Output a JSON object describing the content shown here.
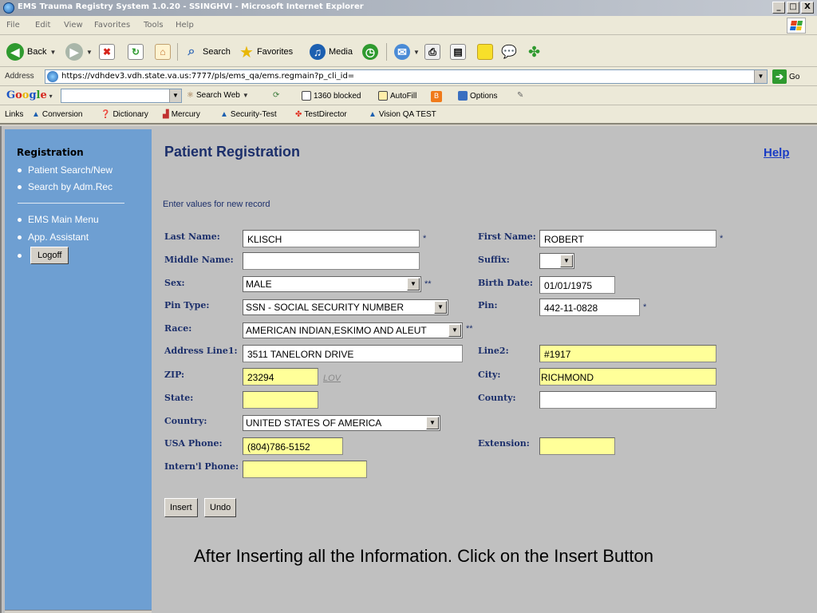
{
  "window": {
    "title": "EMS Trauma Registry System 1.0.20 - SSINGHVI - Microsoft Internet Explorer",
    "minimize": "_",
    "maximize": "□",
    "close": "X"
  },
  "menu": [
    "File",
    "Edit",
    "View",
    "Favorites",
    "Tools",
    "Help"
  ],
  "toolbar": {
    "back": "Back",
    "search": "Search",
    "favorites": "Favorites",
    "media": "Media"
  },
  "address": {
    "label": "Address",
    "url": "https://vdhdev3.vdh.state.va.us:7777/pls/ems_qa/ems.regmain?p_cli_id=",
    "go": "Go"
  },
  "google_bar": {
    "search_web": "Search Web",
    "blocked": "1360 blocked",
    "autofill": "AutoFill",
    "options": "Options"
  },
  "links": {
    "label": "Links",
    "items": [
      "Conversion",
      "Dictionary",
      "Mercury",
      "Security-Test",
      "TestDirector",
      "Vision QA TEST"
    ]
  },
  "sidebar": {
    "heading": "Registration",
    "links": [
      "Patient Search/New",
      "Search by Adm.Rec"
    ],
    "links2": [
      "EMS Main Menu",
      "App. Assistant"
    ],
    "logoff": "Logoff"
  },
  "page": {
    "title": "Patient Registration",
    "help": "Help",
    "instructions": "Enter values for new record"
  },
  "form": {
    "last_name": {
      "label": "Last Name:",
      "value": "KLISCH",
      "req": "*"
    },
    "first_name": {
      "label": "First Name:",
      "value": "ROBERT",
      "req": "*"
    },
    "middle_name": {
      "label": "Middle Name:",
      "value": ""
    },
    "suffix": {
      "label": "Suffix:",
      "value": ""
    },
    "sex": {
      "label": "Sex:",
      "value": "MALE",
      "req": "**"
    },
    "birth_date": {
      "label": "Birth Date:",
      "value": "01/01/1975"
    },
    "pin_type": {
      "label": "Pin Type:",
      "value": "SSN - SOCIAL SECURITY NUMBER"
    },
    "pin": {
      "label": "Pin:",
      "value": "442-11-0828",
      "req": "*"
    },
    "race": {
      "label": "Race:",
      "value": "AMERICAN INDIAN,ESKIMO AND ALEUT",
      "req": "**"
    },
    "address_line1": {
      "label": "Address Line1:",
      "value": "3511 TANELORN DRIVE"
    },
    "line2": {
      "label": "Line2:",
      "value": "#1917"
    },
    "zip": {
      "label": "ZIP:",
      "value": "23294",
      "lov": "LOV"
    },
    "city": {
      "label": "City:",
      "value": "RICHMOND"
    },
    "state": {
      "label": "State:",
      "value": ""
    },
    "county": {
      "label": "County:",
      "value": ""
    },
    "country": {
      "label": "Country:",
      "value": "UNITED STATES OF AMERICA"
    },
    "usa_phone": {
      "label": "USA Phone:",
      "value": "(804)786-5152"
    },
    "extension": {
      "label": "Extension:",
      "value": ""
    },
    "intl_phone": {
      "label": "Intern'l Phone:",
      "value": ""
    }
  },
  "buttons": {
    "insert": "Insert",
    "undo": "Undo"
  },
  "caption": "After Inserting all the Information. Click on the Insert Button",
  "colors": {
    "sidebar": "#6e9fd2",
    "label": "#1c2f6b",
    "highlight_field": "#ffff99",
    "content_bg": "#c0c0c0"
  }
}
